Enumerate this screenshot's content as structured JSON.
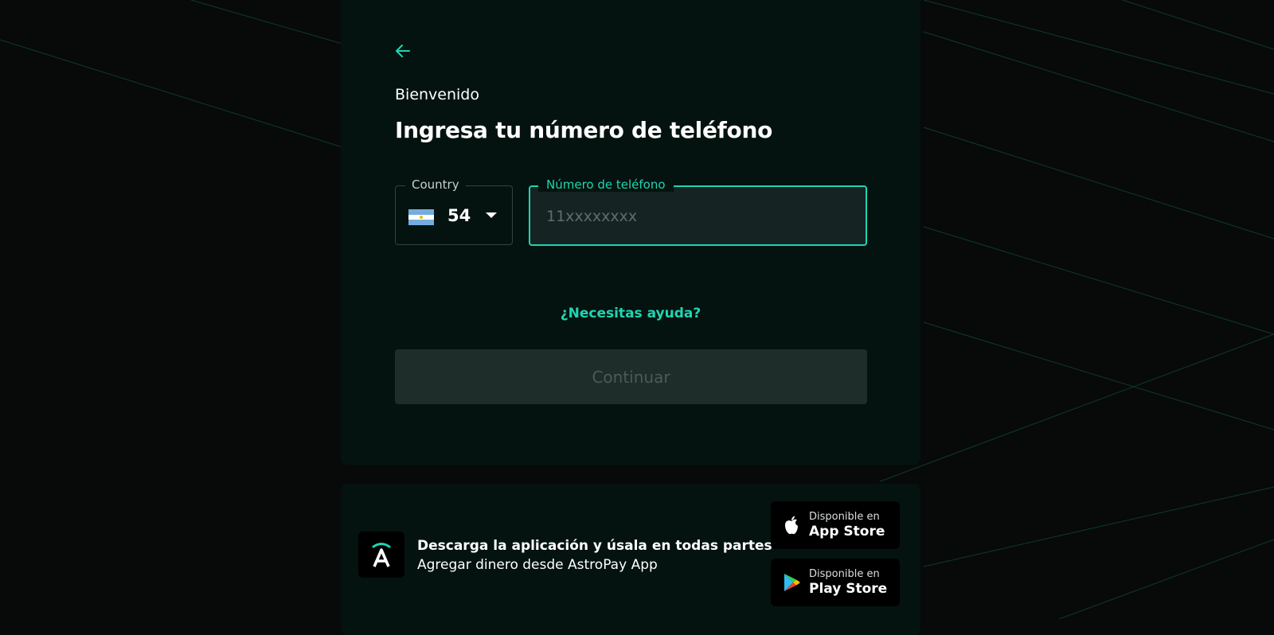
{
  "header": {
    "back_icon": "arrow-left-icon",
    "welcome": "Bienvenido",
    "title": "Ingresa tu número de teléfono"
  },
  "country": {
    "label": "Country",
    "flag_icon": "argentina-flag-icon",
    "code": "54"
  },
  "phone": {
    "label": "Número de teléfono",
    "placeholder": "11xxxxxxxx",
    "value": ""
  },
  "help_link": "¿Necesitas ayuda?",
  "continue_label": "Continuar",
  "footer": {
    "logo_icon": "astropay-logo-icon",
    "promo_title": "Descarga la aplicación y úsala en todas partes",
    "promo_subtitle": "Agregar dinero desde AstroPay App",
    "stores": [
      {
        "small": "Disponible en",
        "big": "App Store",
        "icon": "apple-icon"
      },
      {
        "small": "Disponible en",
        "big": "Play Store",
        "icon": "google-play-icon"
      }
    ]
  },
  "colors": {
    "accent": "#1fd5b2",
    "background": "#070a09",
    "card": "#04130f",
    "disabled_button": "#1f2d2a"
  }
}
